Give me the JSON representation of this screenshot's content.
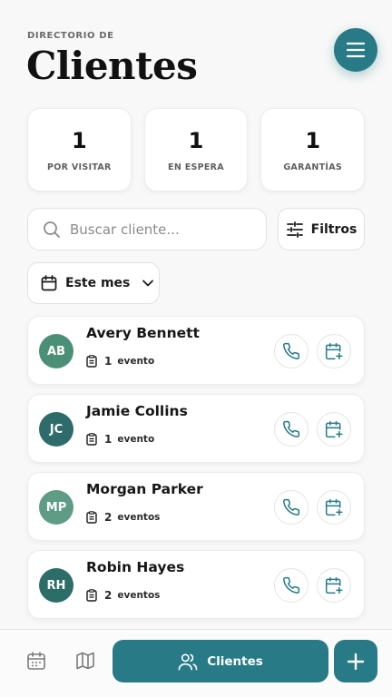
{
  "header": {
    "eyebrow": "DIRECTORIO DE",
    "title": "Clientes"
  },
  "colors": {
    "accent": "#277a86",
    "avatar_palette": [
      "#4c8f77",
      "#2f6b6a",
      "#5e9c86",
      "#2c6d68"
    ]
  },
  "stats": [
    {
      "value": "1",
      "label": "POR VISITAR"
    },
    {
      "value": "1",
      "label": "EN ESPERA"
    },
    {
      "value": "1",
      "label": "GARANTÍAS"
    }
  ],
  "search": {
    "placeholder": "Buscar cliente...",
    "value": ""
  },
  "filters": {
    "label": "Filtros",
    "icon": "sliders-icon"
  },
  "period": {
    "label": "Este mes",
    "icon": "calendar-icon"
  },
  "clients": [
    {
      "initials": "AB",
      "name": "Avery Bennett",
      "events_count": "1",
      "events_unit": "evento"
    },
    {
      "initials": "JC",
      "name": "Jamie Collins",
      "events_count": "1",
      "events_unit": "evento"
    },
    {
      "initials": "MP",
      "name": "Morgan Parker",
      "events_count": "2",
      "events_unit": "eventos"
    },
    {
      "initials": "RH",
      "name": "Robin Hayes",
      "events_count": "2",
      "events_unit": "eventos"
    }
  ],
  "bottom_nav": {
    "active_label": "Clientes",
    "items": [
      "calendar-icon",
      "map-icon",
      "users-icon",
      "plus-icon"
    ]
  }
}
